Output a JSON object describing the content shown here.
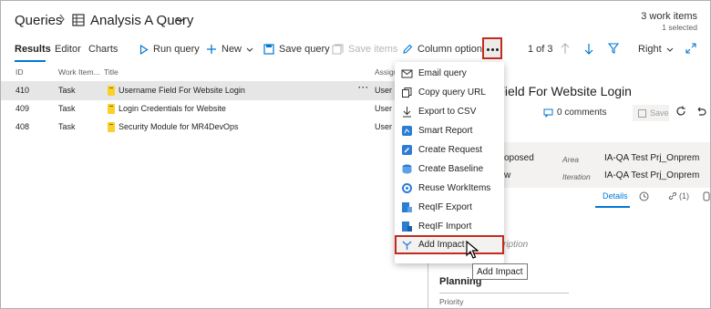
{
  "breadcrumb": {
    "root": "Queries",
    "query_title": "Analysis A Query"
  },
  "work_items": {
    "count": "3 work items",
    "selected": "1 selected"
  },
  "tabs": [
    "Results",
    "Editor",
    "Charts"
  ],
  "toolbar": {
    "run_query": "Run query",
    "new": "New",
    "save_query": "Save query",
    "save_items": "Save items",
    "column_options": "Column options",
    "pager": "1 of 3",
    "view_mode": "Right"
  },
  "columns": {
    "id": "ID",
    "type": "Work Item...",
    "title": "Title",
    "assigned": "Assign"
  },
  "rows": [
    {
      "id": "410",
      "type": "Task",
      "title": "Username Field For Website Login",
      "assigned": "User ("
    },
    {
      "id": "409",
      "type": "Task",
      "title": "Login Credentials for Website",
      "assigned": "User ("
    },
    {
      "id": "408",
      "type": "Task",
      "title": "Security Module for MR4DevOps",
      "assigned": "User ("
    }
  ],
  "detail": {
    "title": "me Field For Website Login",
    "comments": "0 comments",
    "save": "Save",
    "state_value": "oposed",
    "reason_value": "w",
    "area_label": "Area",
    "area_value": "IA-QA Test Prj_Onprem",
    "iteration_label": "Iteration",
    "iteration_value": "IA-QA Test Prj_Onprem",
    "details_tab": "Details",
    "links_tab": "(1)",
    "description_hint": "scription",
    "planning": "Planning",
    "priority_label": "Priority"
  },
  "menu": [
    {
      "label": "Email query",
      "icon": "mail-icon"
    },
    {
      "label": "Copy query URL",
      "icon": "copy-icon"
    },
    {
      "label": "Export to CSV",
      "icon": "download-icon"
    },
    {
      "label": "Smart Report",
      "icon": "smart-report-icon"
    },
    {
      "label": "Create Request",
      "icon": "create-request-icon"
    },
    {
      "label": "Create Baseline",
      "icon": "baseline-icon"
    },
    {
      "label": "Reuse WorkItems",
      "icon": "reuse-icon"
    },
    {
      "label": "ReqIF Export",
      "icon": "reqif-export-icon"
    },
    {
      "label": "ReqIF Import",
      "icon": "reqif-import-icon"
    },
    {
      "label": "Add Impact",
      "icon": "add-impact-icon"
    }
  ],
  "tooltip": "Add Impact",
  "colors": {
    "accent": "#0078d4",
    "highlight_border": "#c42b1c",
    "task_book": "#f8d22a"
  }
}
